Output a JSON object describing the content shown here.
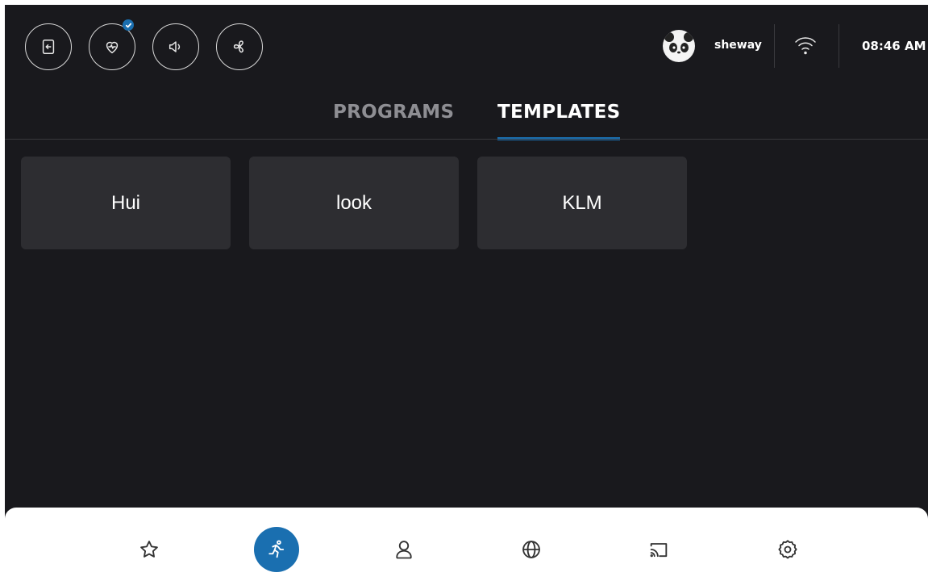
{
  "header": {
    "buttons": [
      {
        "name": "exit-icon"
      },
      {
        "name": "heart-rate-icon",
        "badge": "check"
      },
      {
        "name": "speaker-icon"
      },
      {
        "name": "fan-icon"
      }
    ],
    "user": {
      "name": "sheway",
      "avatar": "panda-avatar"
    },
    "wifi_icon": "wifi-icon",
    "time": "08:46 AM"
  },
  "tabs": [
    {
      "label": "PROGRAMS",
      "active": false
    },
    {
      "label": "TEMPLATES",
      "active": true
    }
  ],
  "templates": [
    {
      "label": "Hui"
    },
    {
      "label": "look"
    },
    {
      "label": "KLM"
    }
  ],
  "bottom_nav": [
    {
      "name": "star-icon",
      "active": false
    },
    {
      "name": "running-icon",
      "active": true
    },
    {
      "name": "user-icon",
      "active": false
    },
    {
      "name": "globe-icon",
      "active": false
    },
    {
      "name": "cast-icon",
      "active": false
    },
    {
      "name": "settings-icon",
      "active": false
    }
  ],
  "colors": {
    "background": "#19191d",
    "card": "#2d2d31",
    "accent": "#1a6fb0",
    "inactive_tab": "#8e8e93"
  }
}
